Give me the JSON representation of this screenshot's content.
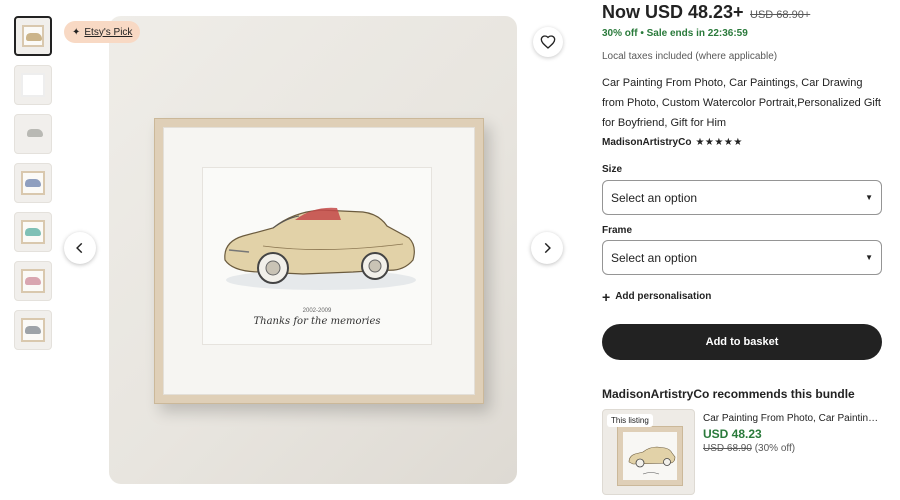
{
  "badge": {
    "label": "Etsy's Pick"
  },
  "thumbnails": [
    {
      "variant": "car-beige",
      "active": true
    },
    {
      "variant": "sheet"
    },
    {
      "variant": "car-sketch"
    },
    {
      "variant": "car-blue"
    },
    {
      "variant": "car-teal"
    },
    {
      "variant": "car-pink"
    },
    {
      "variant": "car-grey"
    }
  ],
  "artwork": {
    "year": "2002-2009",
    "caption": "Thanks for the memories"
  },
  "price": {
    "now": "Now USD 48.23+",
    "original": "USD 68.90+",
    "discount": "30% off",
    "sale_ends": "Sale ends in 22:36:59",
    "taxes_note": "Local taxes included (where applicable)"
  },
  "listing": {
    "title": "Car Painting From Photo, Car Paintings, Car Drawing from Photo, Custom Watercolor Portrait,Personalized Gift for Boyfriend, Gift for Him",
    "shop_name": "MadisonArtistryCo",
    "rating_stars": "★★★★★"
  },
  "options": {
    "size_label": "Size",
    "size_value": "Select an option",
    "frame_label": "Frame",
    "frame_value": "Select an option"
  },
  "personalise_label": "Add personalisation",
  "basket_label": "Add to basket",
  "bundle": {
    "heading": "MadisonArtistryCo recommends this bundle",
    "tag": "This listing",
    "item_title": "Car Painting From Photo, Car Paintings, C...",
    "price": "USD 48.23",
    "original": "USD 68.90",
    "discount": " (30% off)"
  },
  "colors": {
    "sale_green": "#2a7a3b",
    "badge_bg": "#f8d9c4",
    "button_dark": "#222222"
  }
}
